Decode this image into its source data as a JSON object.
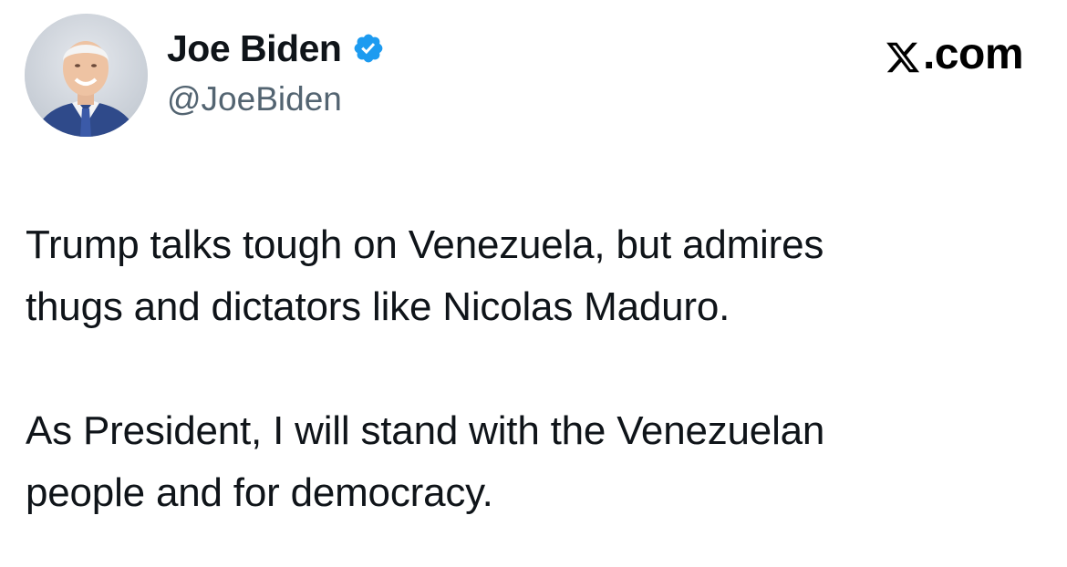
{
  "author": {
    "display_name": "Joe Biden",
    "handle": "@JoeBiden",
    "verified_icon": "verified-badge-icon",
    "verified_color": "#1d9bf0"
  },
  "brand": {
    "label": ".com",
    "logo_icon": "x-logo-icon"
  },
  "tweet": {
    "paragraphs": [
      {
        "line1": "Trump talks tough on Venezuela, but admires",
        "line2": "thugs and dictators like Nicolas Maduro."
      },
      {
        "line1": "As President, I will stand with the Venezuelan",
        "line2": "people and for democracy."
      }
    ]
  },
  "colors": {
    "text": "#0f1419",
    "secondary_text": "#536471",
    "background": "#ffffff"
  }
}
